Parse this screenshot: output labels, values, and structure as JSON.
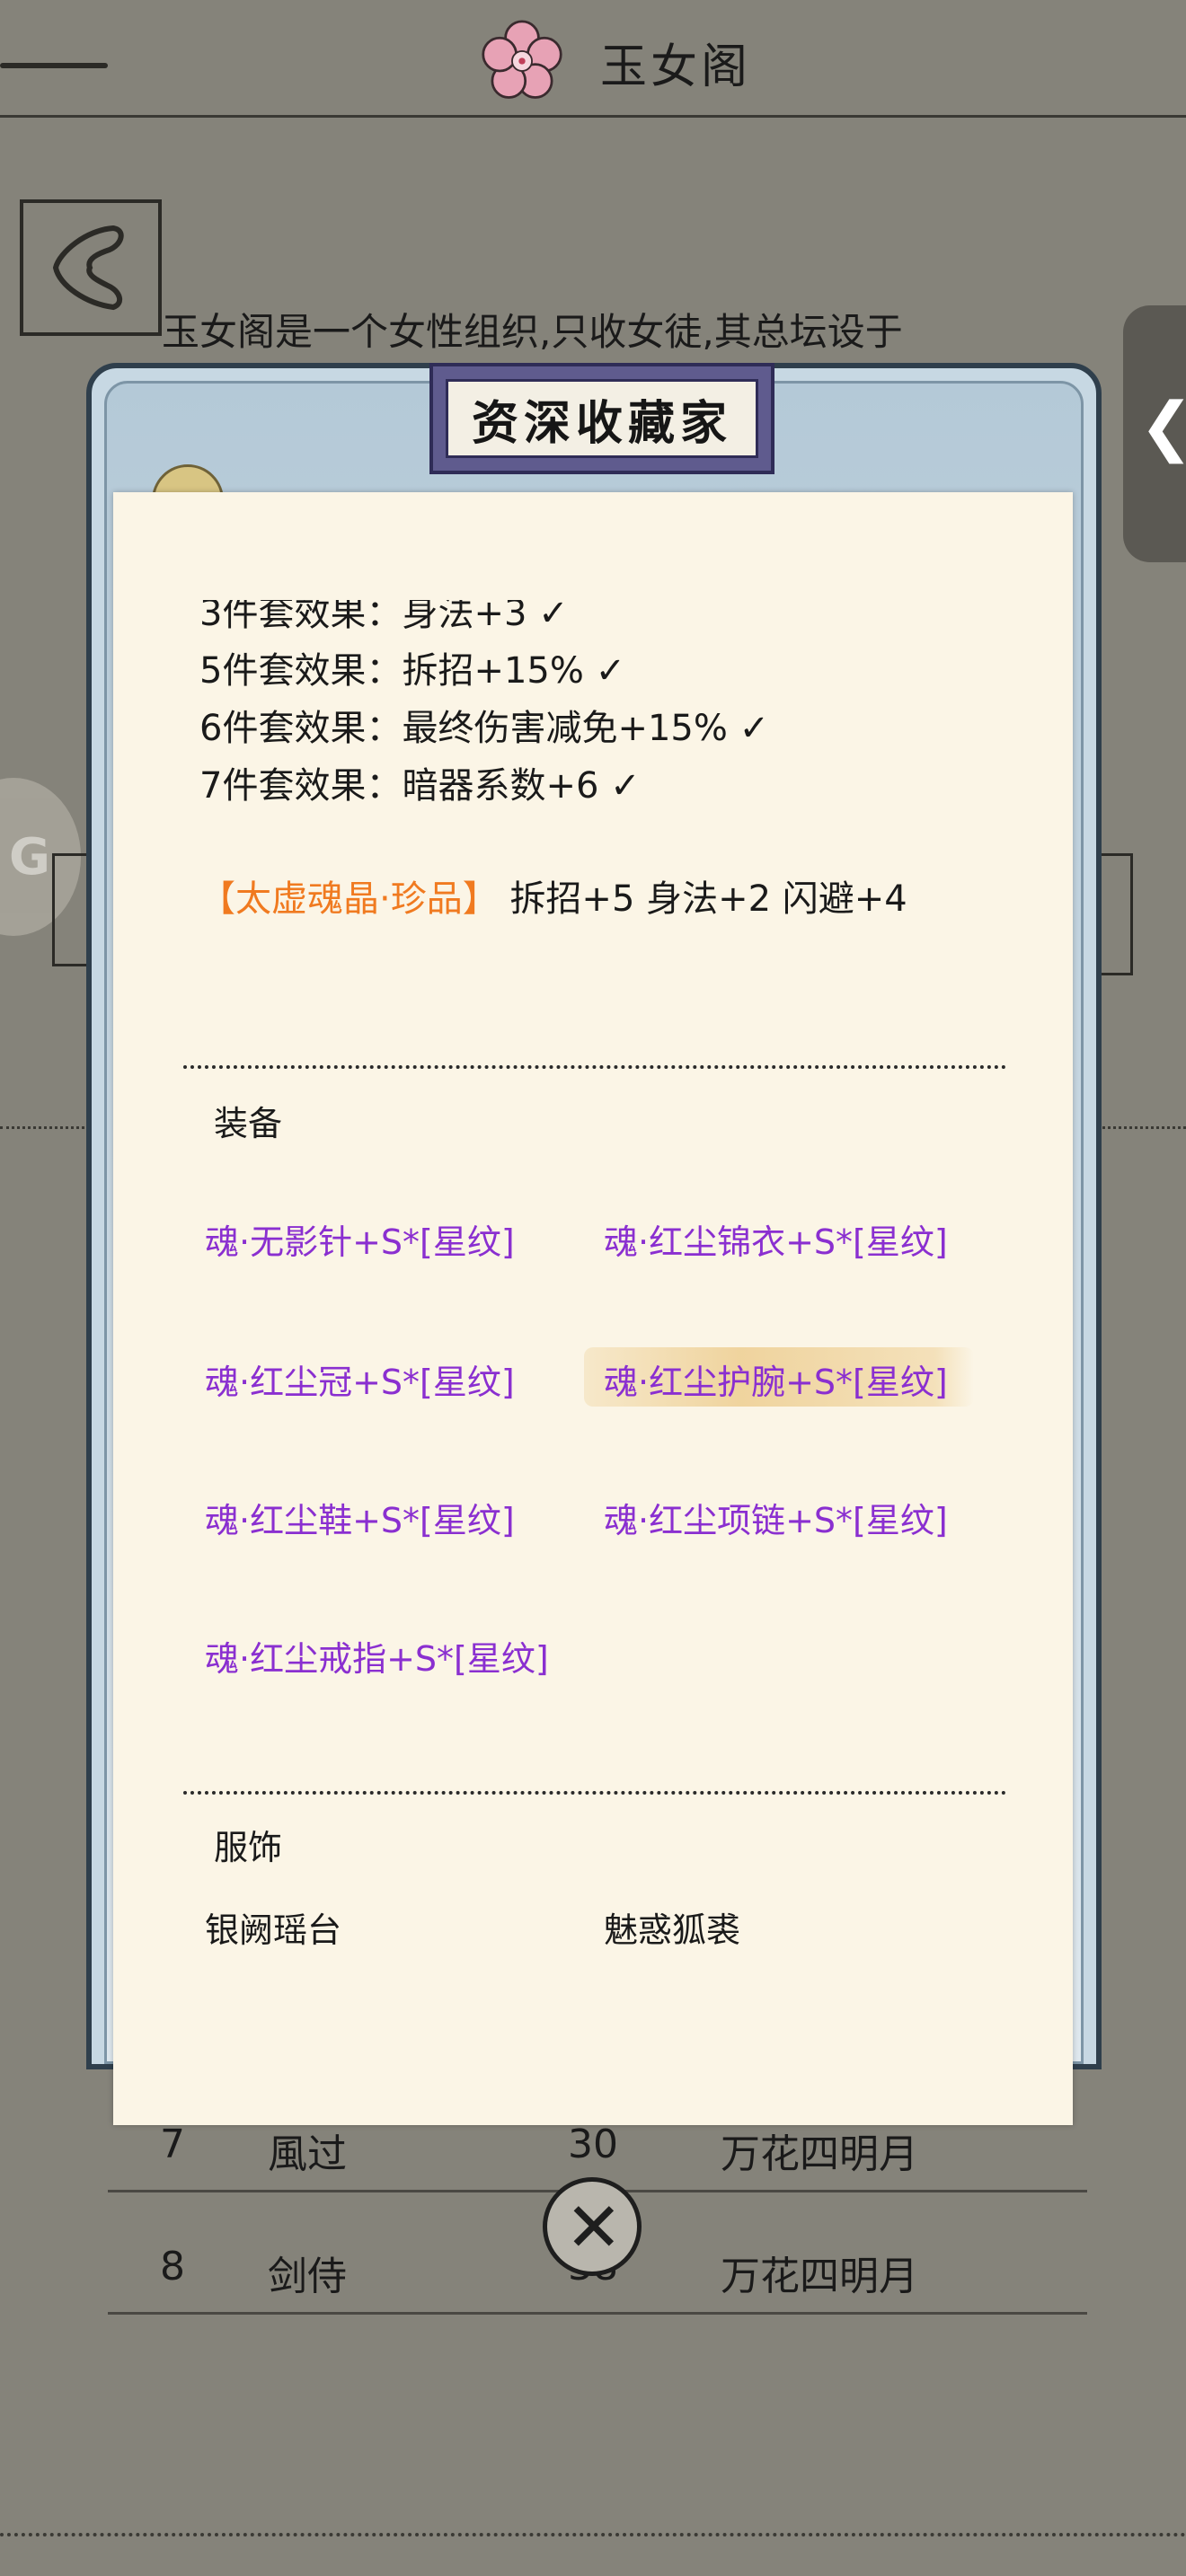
{
  "header": {
    "title": "玉女阁"
  },
  "intro_text": "玉女阁是一个女性组织,只收女徒,其总坛设于",
  "side_tab_glyph": "❮",
  "left_badge_glyph": "G",
  "table_rows": [
    {
      "rank": "7",
      "name": "風过",
      "level": "30",
      "server": "万花四明月"
    },
    {
      "rank": "8",
      "name": "剑侍",
      "level": "38",
      "server": "万花四明月"
    }
  ],
  "popup": {
    "banner_title": "资深收藏家",
    "partial_line": "3件套效果：身法+3 ✓",
    "set_effects": [
      "5件套效果：拆招+15% ✓",
      "6件套效果：最终伤害减免+15% ✓",
      "7件套效果：暗器系数+6 ✓"
    ],
    "gem": {
      "name": "【太虚魂晶·珍品】",
      "stats": "拆招+5 身法+2 闪避+4"
    },
    "equipment_label": "装备",
    "equipment": [
      "魂·无影针+S*[星纹]",
      "魂·红尘锦衣+S*[星纹]",
      "魂·红尘冠+S*[星纹]",
      "魂·红尘护腕+S*[星纹]",
      "魂·红尘鞋+S*[星纹]",
      "魂·红尘项链+S*[星纹]",
      "魂·红尘戒指+S*[星纹]"
    ],
    "costume_label": "服饰",
    "costumes": [
      "银阙瑶台",
      "魅惑狐裘"
    ]
  },
  "colors": {
    "background": "#85837a",
    "paper": "#fbf5e6",
    "equipment_text": "#8a2fd0",
    "gem_text": "#f07a20",
    "frame": "#c7d8e3",
    "banner": "#5f5b8e"
  }
}
